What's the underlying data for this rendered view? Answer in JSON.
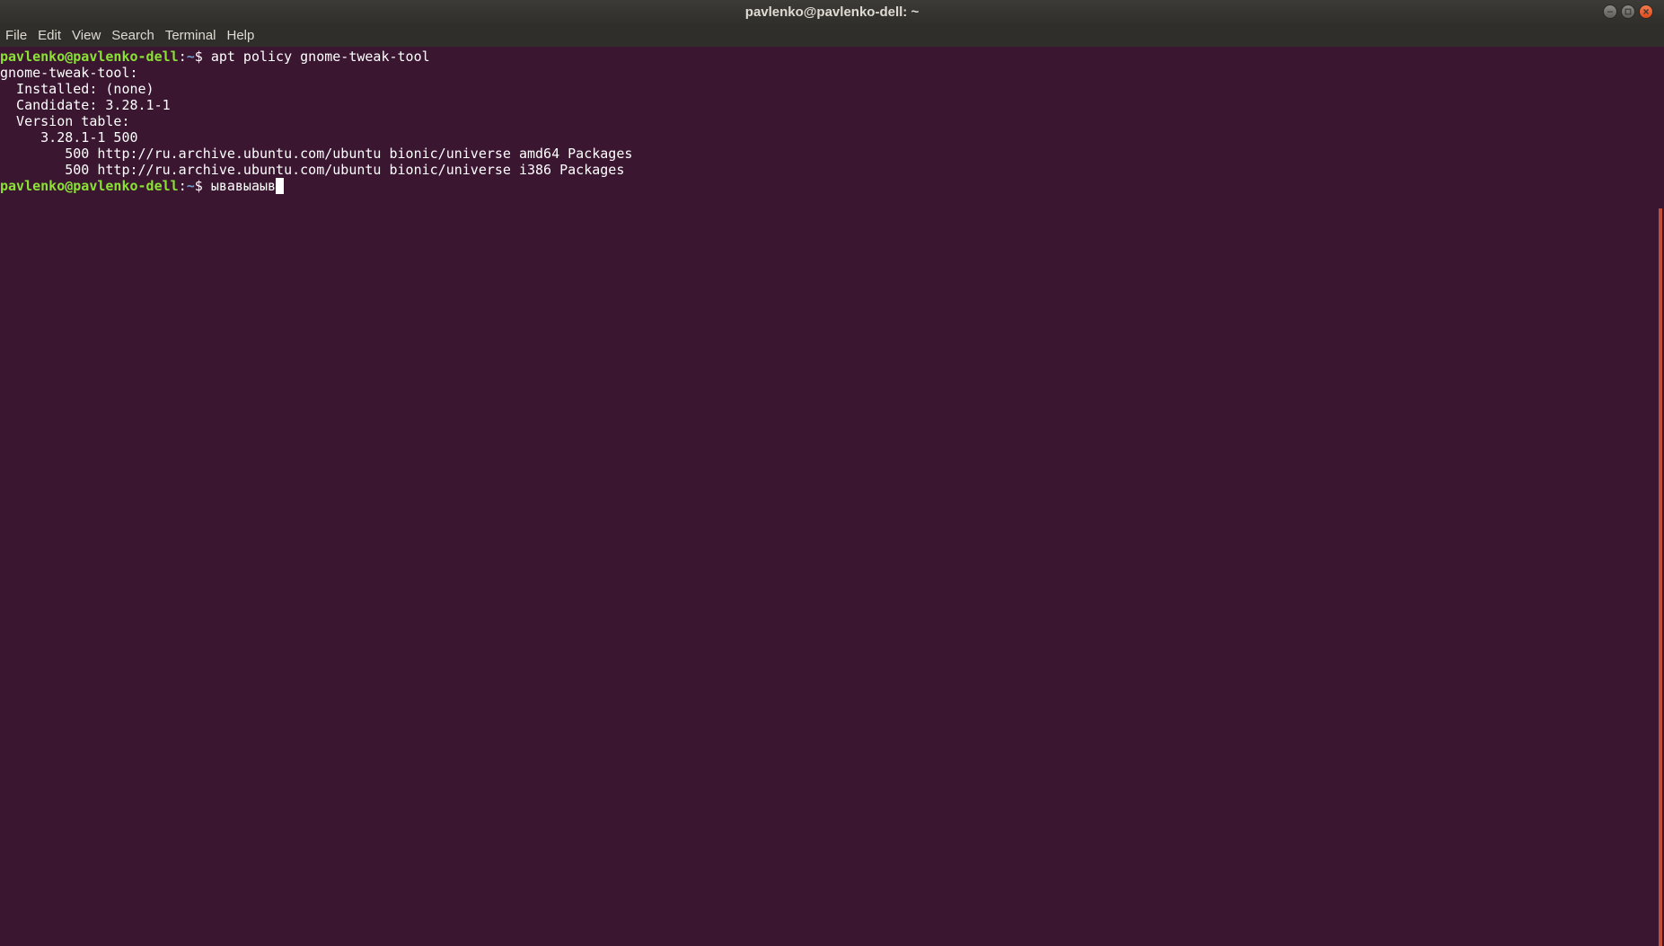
{
  "window": {
    "title": "pavlenko@pavlenko-dell: ~",
    "controls": [
      "minimize",
      "maximize",
      "close"
    ]
  },
  "menubar": {
    "items": [
      {
        "label": "File"
      },
      {
        "label": "Edit"
      },
      {
        "label": "View"
      },
      {
        "label": "Search"
      },
      {
        "label": "Terminal"
      },
      {
        "label": "Help"
      }
    ]
  },
  "terminal": {
    "prompt_user_host": "pavlenko@pavlenko-dell",
    "prompt_colon": ":",
    "prompt_path": "~",
    "prompt_symbol": "$ ",
    "command1": "apt policy gnome-tweak-tool",
    "output": [
      "gnome-tweak-tool:",
      "  Installed: (none)",
      "  Candidate: 3.28.1-1",
      "  Version table:",
      "     3.28.1-1 500",
      "        500 http://ru.archive.ubuntu.com/ubuntu bionic/universe amd64 Packages",
      "        500 http://ru.archive.ubuntu.com/ubuntu bionic/universe i386 Packages"
    ],
    "current_input": "ывавыаыв"
  },
  "colors": {
    "background": "#3a1631",
    "prompt_user": "#8ae234",
    "prompt_path": "#729fcf",
    "text": "#ffffff",
    "scrollbar": "#e05d3d"
  }
}
